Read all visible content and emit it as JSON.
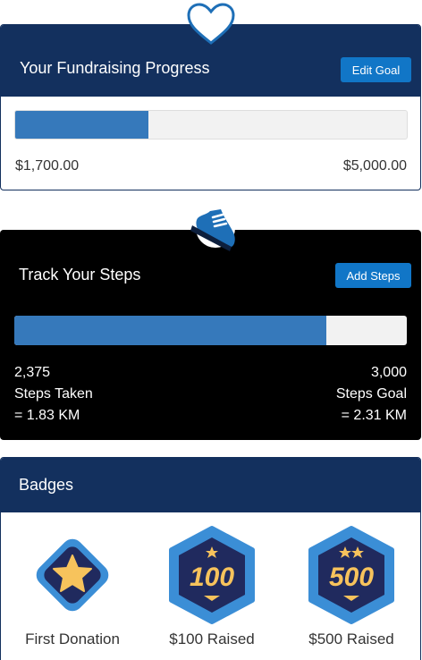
{
  "fundraising": {
    "title": "Your Fundraising Progress",
    "edit_button": "Edit Goal",
    "raised": "$1,700.00",
    "goal": "$5,000.00",
    "progress_fraction": 0.34,
    "icon": "heart-icon"
  },
  "steps": {
    "title": "Track Your Steps",
    "add_button": "Add Steps",
    "progress_fraction": 0.795,
    "taken": {
      "value": "2,375",
      "label": "Steps Taken",
      "distance": "= 1.83 KM"
    },
    "goal": {
      "value": "3,000",
      "label": "Steps Goal",
      "distance": "= 2.31 KM"
    },
    "icon": "sneaker-icon"
  },
  "badges": {
    "title": "Badges",
    "items": [
      {
        "label": "First Donation",
        "icon": "star-badge-icon"
      },
      {
        "label": "$100 Raised",
        "number": "100",
        "icon": "hundred-badge-icon"
      },
      {
        "label": "$500 Raised",
        "number": "500",
        "icon": "five-hundred-badge-icon"
      }
    ]
  },
  "colors": {
    "navy": "#13305e",
    "accent": "#1176c7",
    "bar_fill": "#3679bb",
    "badge_gold": "#f7c35c"
  }
}
